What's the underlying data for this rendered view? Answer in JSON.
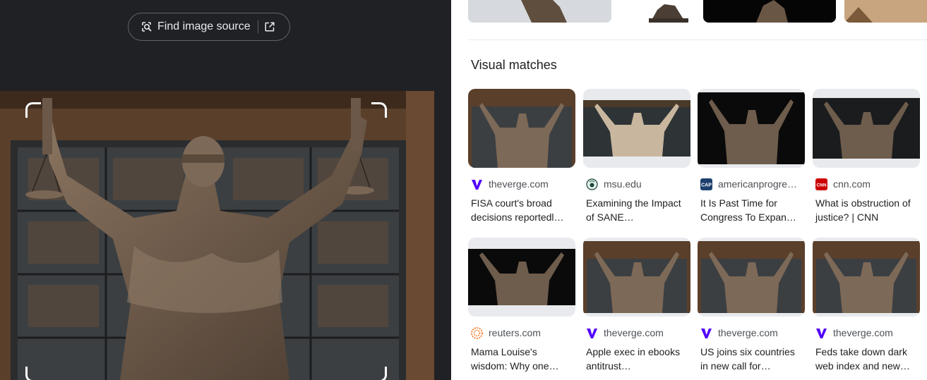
{
  "find_source": {
    "label": "Find image source",
    "icon": "lens-search-icon",
    "external_icon": "open-in-new-icon"
  },
  "visual_matches": {
    "heading": "Visual matches",
    "items": [
      {
        "domain": "theverge.com",
        "title": "FISA court's broad decisions reportedl…",
        "favicon": "verge-favicon",
        "favicon_color": "#5200ff"
      },
      {
        "domain": "msu.edu",
        "title": "Examining the Impact of SANE…",
        "favicon": "msu-favicon",
        "favicon_color": "#18453b"
      },
      {
        "domain": "americanprogre…",
        "title": "It Is Past Time for Congress To Expan…",
        "favicon": "cap-favicon",
        "favicon_color": "#1c3f6e"
      },
      {
        "domain": "cnn.com",
        "title": "What is obstruction of justice? | CNN",
        "favicon": "cnn-favicon",
        "favicon_color": "#cc0000"
      },
      {
        "domain": "reuters.com",
        "title": "Mama Louise's wisdom: Why one…",
        "favicon": "reuters-favicon",
        "favicon_color": "#fa6400"
      },
      {
        "domain": "theverge.com",
        "title": "Apple exec in ebooks antitrust…",
        "favicon": "verge-favicon",
        "favicon_color": "#5200ff"
      },
      {
        "domain": "theverge.com",
        "title": "US joins six countries in new call for…",
        "favicon": "verge-favicon",
        "favicon_color": "#5200ff"
      },
      {
        "domain": "theverge.com",
        "title": "Feds take down dark web index and new…",
        "favicon": "verge-favicon",
        "favicon_color": "#5200ff"
      }
    ]
  },
  "colors": {
    "dark_bg": "#202124",
    "accent_verge": "#5200ff"
  }
}
